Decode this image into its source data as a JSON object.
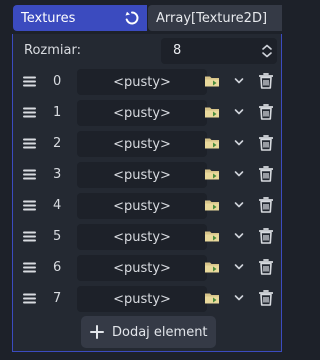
{
  "property": {
    "name": "Textures",
    "type": "Array[Texture2D]",
    "accent_color": "#3b4bbf"
  },
  "size": {
    "label": "Rozmiar:",
    "value": "8"
  },
  "elements": [
    {
      "index": "0",
      "value": "<pusty>"
    },
    {
      "index": "1",
      "value": "<pusty>"
    },
    {
      "index": "2",
      "value": "<pusty>"
    },
    {
      "index": "3",
      "value": "<pusty>"
    },
    {
      "index": "4",
      "value": "<pusty>"
    },
    {
      "index": "5",
      "value": "<pusty>"
    },
    {
      "index": "6",
      "value": "<pusty>"
    },
    {
      "index": "7",
      "value": "<pusty>"
    }
  ],
  "add_button": {
    "label": "Dodaj element"
  },
  "icons": {
    "revert": "revert-icon",
    "spinner": "updown-spinner-icon",
    "drag": "drag-handle-icon",
    "load": "folder-load-icon",
    "menu": "chevron-down-icon",
    "remove": "trash-icon",
    "add": "plus-icon"
  }
}
